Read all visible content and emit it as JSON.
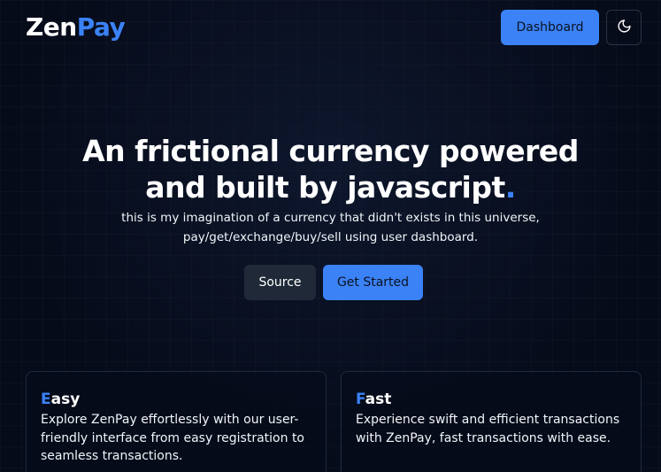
{
  "header": {
    "logo_main": "Zen",
    "logo_accent": "Pay",
    "dashboard_label": "Dashboard",
    "theme_icon": "moon-icon"
  },
  "hero": {
    "title_line1": "An frictional currency powered",
    "title_line2": "and built by javascript",
    "title_dot": ".",
    "subtitle_line1": "this is my imagination of a currency that didn't exists in this universe,",
    "subtitle_line2": "pay/get/exchange/buy/sell using user dashboard.",
    "source_label": "Source",
    "get_started_label": "Get Started"
  },
  "features": [
    {
      "title_first": "E",
      "title_rest": "asy",
      "text": "Explore ZenPay effortlessly with our user-friendly interface from easy registration to seamless transactions."
    },
    {
      "title_first": "F",
      "title_rest": "ast",
      "text": "Experience swift and efficient transactions with ZenPay, fast transactions with ease."
    }
  ],
  "colors": {
    "accent": "#3b82f6",
    "background": "#060b19",
    "secondary_button": "#1f2937"
  }
}
